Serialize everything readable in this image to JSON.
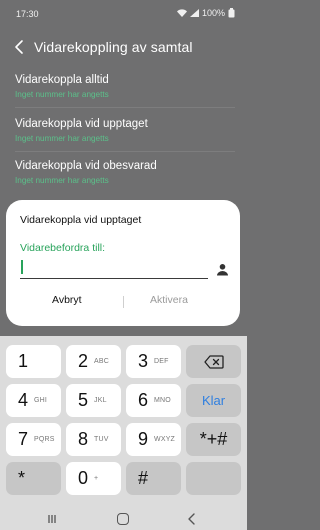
{
  "status_bar": {
    "time": "17:30",
    "battery": "100%"
  },
  "header": {
    "title": "Vidarekoppling av samtal"
  },
  "list": [
    {
      "title": "Vidarekoppla alltid",
      "subtitle": "Inget nummer har angetts"
    },
    {
      "title": "Vidarekoppla vid upptaget",
      "subtitle": "Inget nummer har angetts"
    },
    {
      "title": "Vidarekoppla vid obesvarad",
      "subtitle": "Inget nummer har angetts"
    }
  ],
  "dialog": {
    "title": "Vidarekoppla vid upptaget",
    "field_label": "Vidarebefordra till:",
    "field_value": "",
    "cancel_label": "Avbryt",
    "activate_label": "Aktivera"
  },
  "keyboard": {
    "keys": [
      {
        "digit": "1",
        "letters": ""
      },
      {
        "digit": "2",
        "letters": "ABC"
      },
      {
        "digit": "3",
        "letters": "DEF"
      },
      {
        "digit": "4",
        "letters": "GHI"
      },
      {
        "digit": "5",
        "letters": "JKL"
      },
      {
        "digit": "6",
        "letters": "MNO"
      },
      {
        "digit": "7",
        "letters": "PQRS"
      },
      {
        "digit": "8",
        "letters": "TUV"
      },
      {
        "digit": "9",
        "letters": "WXYZ"
      },
      {
        "digit": "0",
        "letters": "+"
      }
    ],
    "star_label": "*",
    "hash_label": "#",
    "star_hash_label": "*+#",
    "done_label": "Klar"
  },
  "colors": {
    "accent_green": "#28a35b",
    "klar_blue": "#2f7fe0"
  }
}
